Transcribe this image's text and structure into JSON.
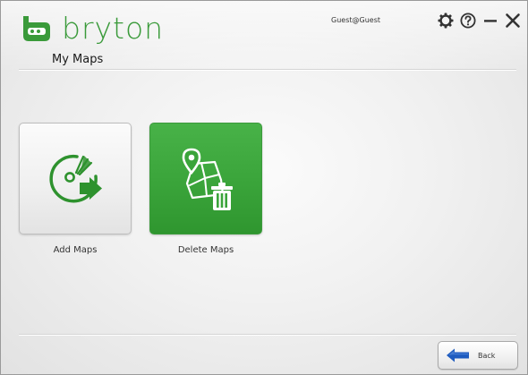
{
  "header": {
    "logo_text": "bryton",
    "page_title": "My Maps",
    "user": "Guest@Guest"
  },
  "window_controls": {
    "icons": [
      "gear-icon",
      "help-icon",
      "minimize-icon",
      "close-icon"
    ]
  },
  "tiles": [
    {
      "label": "Add Maps",
      "icon": "add-map-icon",
      "style": "light"
    },
    {
      "label": "Delete Maps",
      "icon": "delete-map-icon",
      "style": "green"
    }
  ],
  "footer": {
    "back_label": "Back",
    "back_icon": "left-arrow-icon"
  },
  "colors": {
    "brand_green": "#3a9a3a",
    "tile_green": "#3aa43a",
    "back_arrow_blue": "#1e5bbf"
  }
}
